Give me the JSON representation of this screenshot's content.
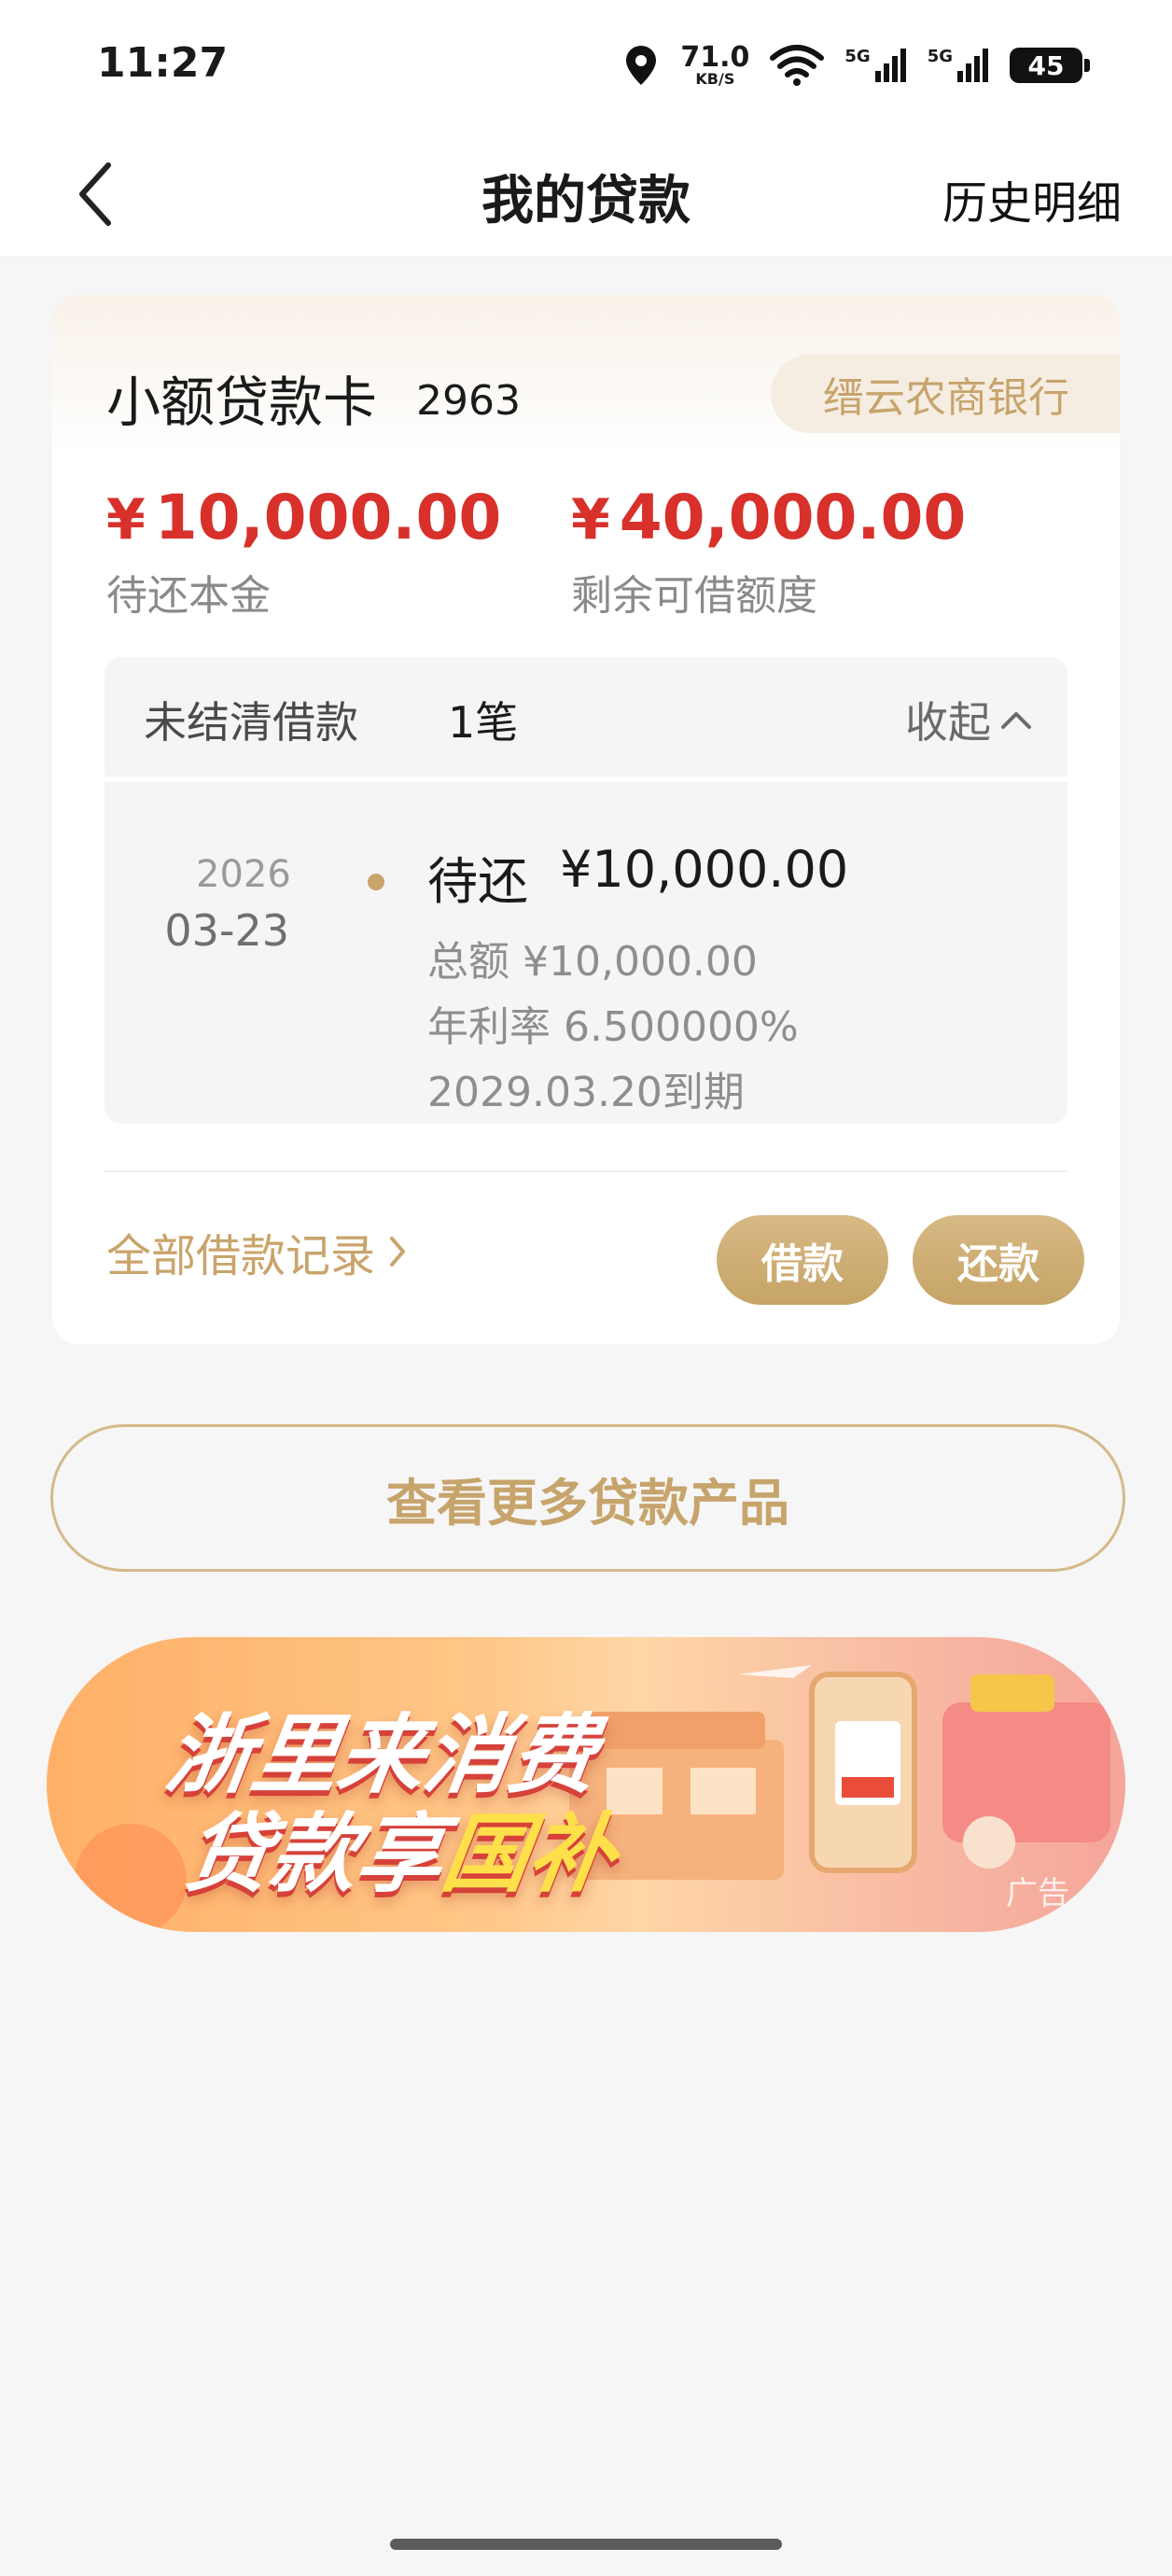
{
  "status_bar": {
    "time": "11:27",
    "net_speed": "71.0",
    "net_speed_unit": "KB/S",
    "signal_1": "5G",
    "signal_2": "5G",
    "battery": "45"
  },
  "header": {
    "title": "我的贷款",
    "history_link": "历史明细"
  },
  "card": {
    "name": "小额贷款卡",
    "number": "2963",
    "bank": "缙云农商银行",
    "principal": {
      "currency": "¥",
      "value": "10,000.00",
      "label": "待还本金"
    },
    "remaining_limit": {
      "currency": "¥",
      "value": "40,000.00",
      "label": "剩余可借额度"
    },
    "pending": {
      "title": "未结清借款",
      "count": "1笔",
      "collapse_label": "收起",
      "loan": {
        "year": "2026",
        "month_day": "03-23",
        "status": "待还",
        "amount": "¥10,000.00",
        "total": "总额 ¥10,000.00",
        "rate": "年利率 6.500000%",
        "due": "2029.03.20到期"
      }
    },
    "records_link": "全部借款记录",
    "borrow_button": "借款",
    "repay_button": "还款"
  },
  "more_products_button": "查看更多贷款产品",
  "banner": {
    "line1": "浙里来消费",
    "line2_a": "贷款享",
    "line2_b": "国补",
    "ad_label": "广告"
  },
  "colors": {
    "accent_gold": "#c9a46b",
    "amount_red": "#d8302a"
  }
}
